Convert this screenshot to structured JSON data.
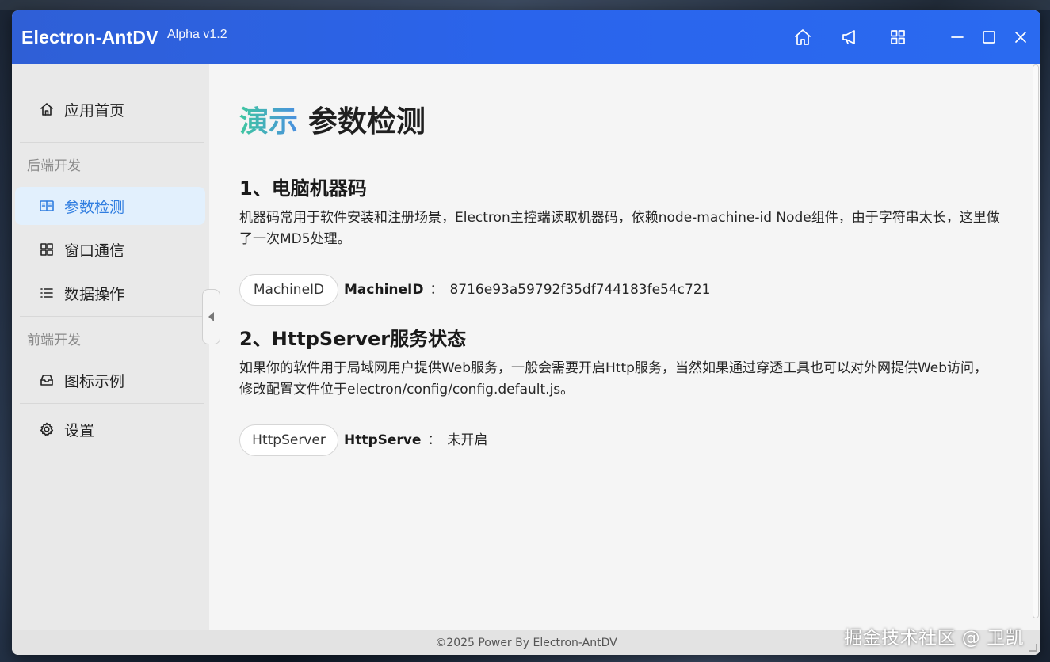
{
  "window": {
    "title": "Electron-AntDV",
    "version": "Alpha v1.2",
    "icons": [
      "home-icon",
      "notification-icon",
      "apps-icon",
      "minimize-icon",
      "maximize-icon",
      "close-icon"
    ]
  },
  "sidebar": {
    "items": [
      {
        "label": "应用首页",
        "icon": "home-icon"
      },
      {
        "label": "参数检测",
        "icon": "book-icon",
        "active": true
      },
      {
        "label": "窗口通信",
        "icon": "window-icon"
      },
      {
        "label": "数据操作",
        "icon": "list-icon"
      },
      {
        "label": "图标示例",
        "icon": "inbox-icon"
      },
      {
        "label": "设置",
        "icon": "gear-icon"
      }
    ],
    "groups": {
      "backend": "后端开发",
      "frontend": "前端开发"
    }
  },
  "main": {
    "title_accent": "演示",
    "title": "参数检测",
    "sections": [
      {
        "title": "1、电脑机器码",
        "description": "机器码常用于软件安装和注册场景，Electron主控端读取机器码，依赖node-machine-id Node组件，由于字符串太长，这里做了一次MD5处理。",
        "button_label": "MachineID",
        "key": "MachineID",
        "separator": "：",
        "value": "8716e93a59792f35df744183fe54c721"
      },
      {
        "title": "2、HttpServer服务状态",
        "description": "如果你的软件用于局域网用户提供Web服务，一般会需要开启Http服务，当然如果通过穿透工具也可以对外网提供Web访问，修改配置文件位于electron/config/config.default.js。",
        "button_label": "HttpServer",
        "key": "HttpServe",
        "separator": "：",
        "value": "未开启"
      }
    ]
  },
  "footer": {
    "text": "©2025 Power By Electron-AntDV"
  },
  "watermark": "掘金技术社区 @ 卫凯",
  "colors": {
    "titlebar": "#2a64ec",
    "active_item_bg": "#e2f0fd",
    "active_item_text": "#2f7de0"
  }
}
